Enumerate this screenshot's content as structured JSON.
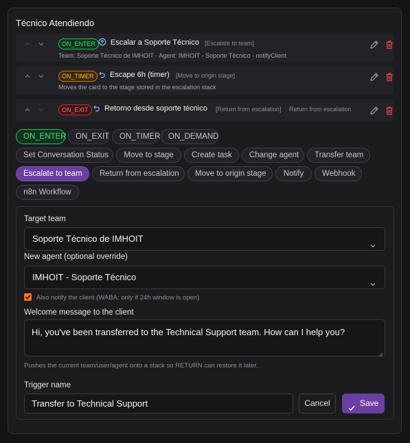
{
  "panel": {
    "title": "Técnico Atendiendo"
  },
  "triggers": [
    {
      "badge": "ON_ENTER",
      "title": "Escalar a Soporte Técnico",
      "tag": "[Escalate to team]",
      "subtitle": "Team: Soporte Técnico de IMHOIT · Agent: IMHOIT - Soporte Técnico · notifyClient",
      "icon": "arrow-up-circle-icon"
    },
    {
      "badge": "ON_TIMER",
      "title": "Escape 6h (timer)",
      "tag": "[Move to origin stage]",
      "subtitle": "Moves the card to the stage stored in the escalation stack",
      "icon": "undo-arrow-icon"
    },
    {
      "badge": "ON_EXIT",
      "title": "Retorno desde soporte técnico",
      "tag": "[Return from escalation]",
      "extra": "Return from escalation",
      "icon": "undo-arrow-icon"
    }
  ],
  "event_chips": [
    "ON_ENTER",
    "ON_EXIT",
    "ON_TIMER",
    "ON_DEMAND"
  ],
  "action_chips": [
    "Set Conversation Status",
    "Move to stage",
    "Create task",
    "Change agent",
    "Transfer team",
    "Escalate to team",
    "Return from escalation",
    "Move to origin stage",
    "Notify",
    "Webhook",
    "n8n Workflow"
  ],
  "form": {
    "target_team_label": "Target team",
    "target_team_value": "Soporte Técnico de IMHOIT",
    "new_agent_label": "New agent (optional override)",
    "new_agent_value": "IMHOIT - Soporte Técnico",
    "notify_label": "Also notify the client (WABA: only if 24h window is open)",
    "notify_checked": true,
    "welcome_label": "Welcome message to the client",
    "welcome_value": "Hi, you've been transferred to the Technical Support team. How can I help you?",
    "stack_hint": "Pushes the current team/user/agent onto a stack so RETURN can restore it later.",
    "trigger_name_label": "Trigger name",
    "trigger_name_value": "Transfer to Technical Support",
    "cancel_label": "Cancel",
    "save_label": "Save"
  },
  "colors": {
    "accent": "#6b3fa0",
    "on_enter": "#22c55e",
    "on_timer": "#d97706",
    "on_exit": "#dc2626",
    "delete": "#ef4444",
    "checkbox": "#f97316"
  }
}
